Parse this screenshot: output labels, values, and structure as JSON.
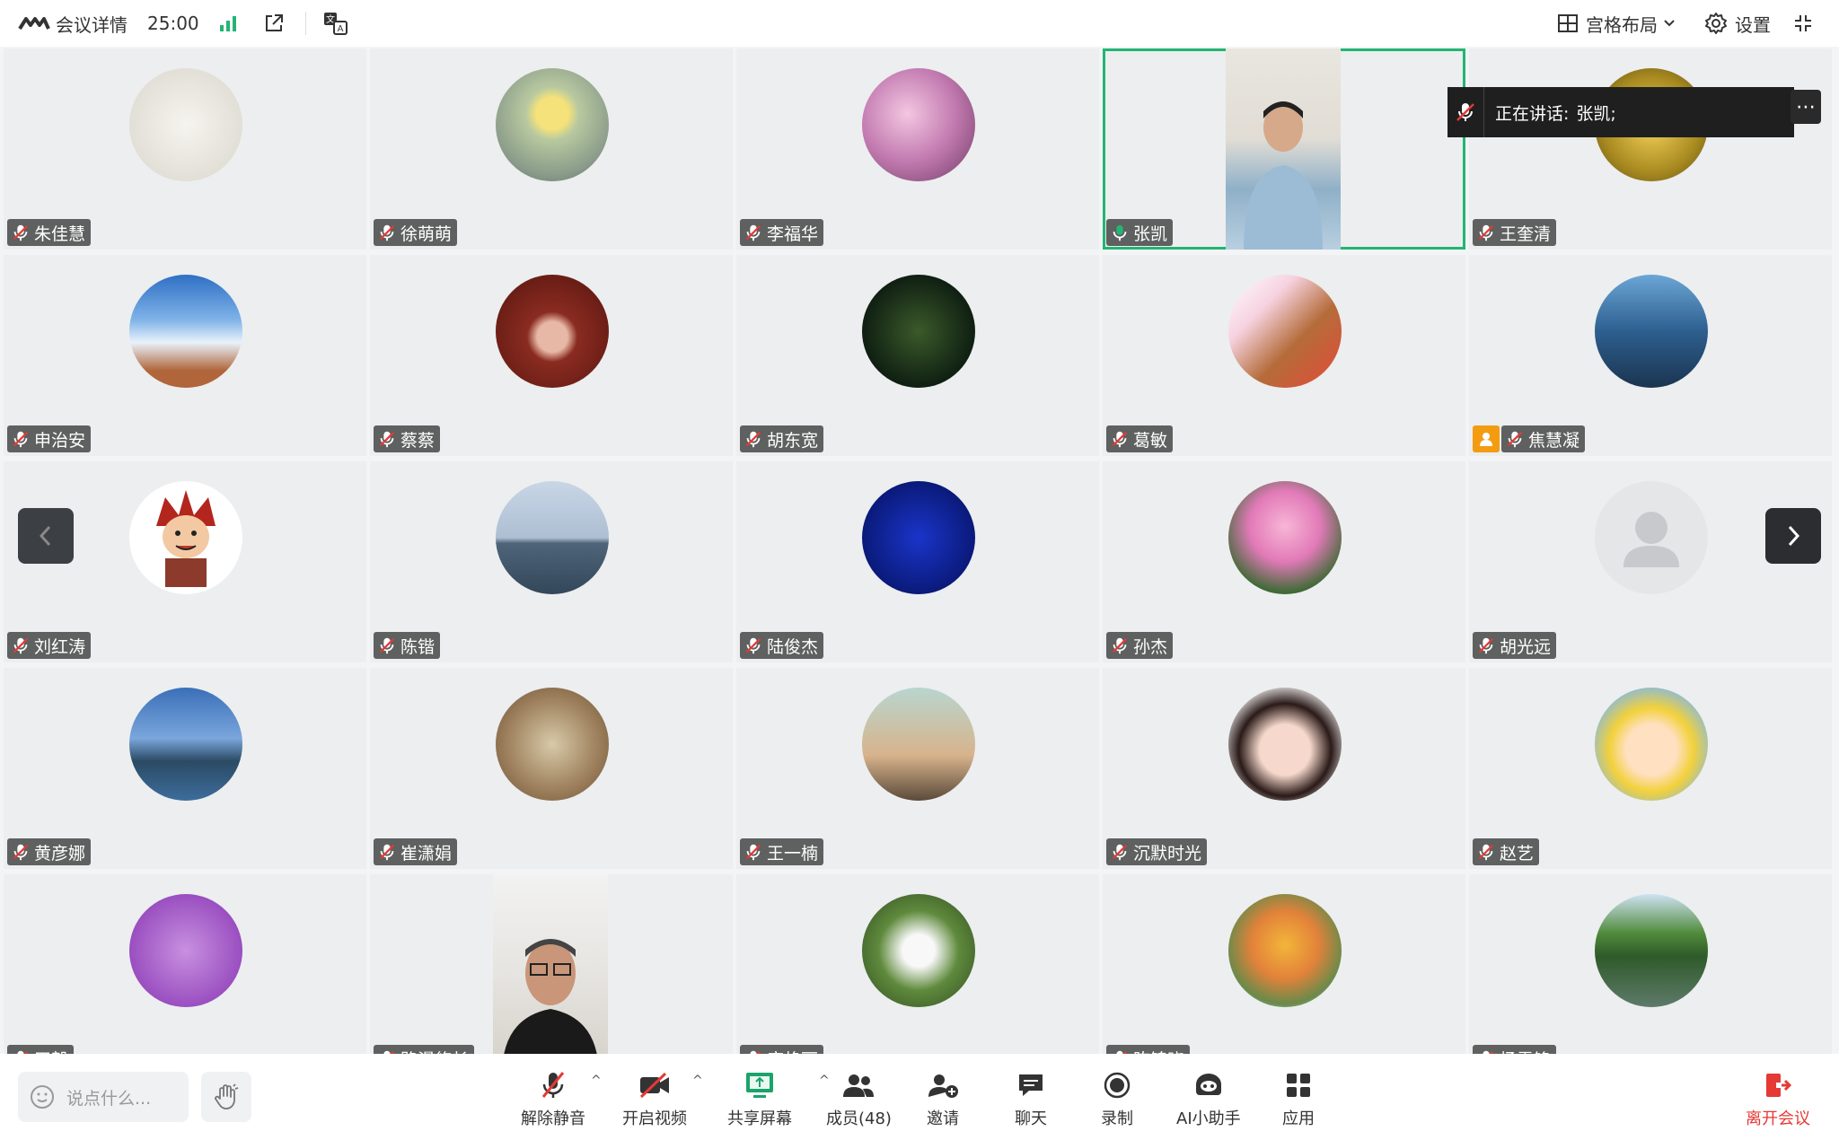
{
  "topbar": {
    "title": "会议详情",
    "time": "25:00",
    "layout_label": "宫格布局",
    "settings_label": "设置",
    "icons": [
      "meeting-logo-icon",
      "signal-icon",
      "external-link-icon",
      "translate-icon",
      "grid-layout-icon",
      "chevron-down-icon",
      "gear-icon",
      "collapse-icon"
    ]
  },
  "speaking": {
    "label": "正在讲话:",
    "name": "张凯;"
  },
  "participants": [
    {
      "name": "朱佳慧",
      "avatar": "sketch-hand",
      "muted": true
    },
    {
      "name": "徐萌萌",
      "avatar": "yellow-flowers",
      "muted": true
    },
    {
      "name": "李福华",
      "avatar": "pink-blossoms",
      "muted": true
    },
    {
      "name": "张凯",
      "avatar": "video",
      "muted": false,
      "speaking": true
    },
    {
      "name": "王奎清",
      "avatar": "gold-object",
      "muted": true
    },
    {
      "name": "申治安",
      "avatar": "mountain-clouds",
      "muted": true
    },
    {
      "name": "蔡蔡",
      "avatar": "curly-hair-cartoon",
      "muted": true
    },
    {
      "name": "胡东宽",
      "avatar": "white-blossoms-dark",
      "muted": true
    },
    {
      "name": "葛敏",
      "avatar": "teddy-bear",
      "muted": true
    },
    {
      "name": "焦慧凝",
      "avatar": "waterfall",
      "muted": true,
      "host": true
    },
    {
      "name": "刘红涛",
      "avatar": "red-hair-cartoon",
      "muted": true
    },
    {
      "name": "陈锴",
      "avatar": "sea-horizon",
      "muted": true
    },
    {
      "name": "陆俊杰",
      "avatar": "night-sky",
      "muted": true
    },
    {
      "name": "孙杰",
      "avatar": "pink-roses",
      "muted": true
    },
    {
      "name": "胡光远",
      "avatar": "default-user",
      "muted": true
    },
    {
      "name": "黄彦娜",
      "avatar": "lake-islands",
      "muted": true
    },
    {
      "name": "崔潇娟",
      "avatar": "pebbles",
      "muted": true
    },
    {
      "name": "王一楠",
      "avatar": "reading-cartoon",
      "muted": true
    },
    {
      "name": "沉默时光",
      "avatar": "girl-red-bow",
      "muted": true
    },
    {
      "name": "赵艺",
      "avatar": "shinchan-cartoon",
      "muted": true
    },
    {
      "name": "王毅",
      "avatar": "purple-painting",
      "muted": true
    },
    {
      "name": "路漫悠长",
      "avatar": "video2",
      "muted": true
    },
    {
      "name": "麻艳丽",
      "avatar": "white-flowers",
      "muted": true
    },
    {
      "name": "陈锦晓",
      "avatar": "flower-bouquet",
      "muted": true
    },
    {
      "name": "杨雷锋",
      "avatar": "trees-reflection",
      "muted": true
    }
  ],
  "bottombar": {
    "chat_placeholder": "说点什么...",
    "tools": [
      {
        "label": "解除静音",
        "icon": "mic-muted-icon"
      },
      {
        "label": "开启视频",
        "icon": "video-off-icon"
      },
      {
        "label": "共享屏幕",
        "icon": "share-screen-icon"
      },
      {
        "label": "成员(48)",
        "icon": "members-icon"
      },
      {
        "label": "邀请",
        "icon": "invite-icon"
      },
      {
        "label": "聊天",
        "icon": "chat-icon"
      },
      {
        "label": "录制",
        "icon": "record-icon"
      },
      {
        "label": "AI小助手",
        "icon": "ai-assistant-icon"
      },
      {
        "label": "应用",
        "icon": "apps-icon"
      }
    ],
    "leave_label": "离开会议"
  },
  "colors": {
    "speaking_outline": "#22b573",
    "leave_red": "#e53935",
    "signal_green": "#22b573",
    "host_badge": "#f39c12"
  }
}
